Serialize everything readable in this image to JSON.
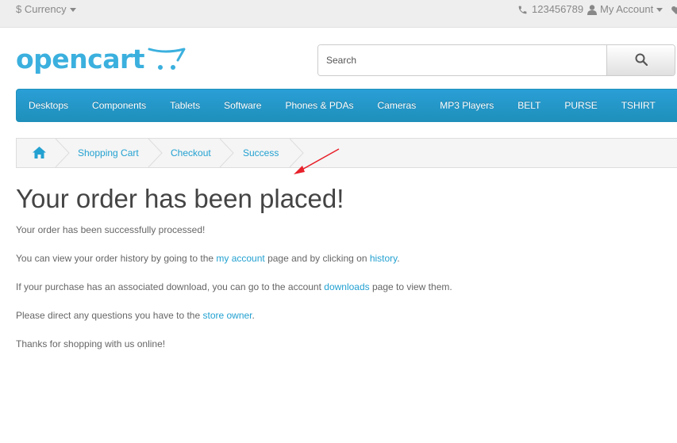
{
  "topbar": {
    "currency_label": "$ Currency",
    "phone": "123456789",
    "account_label": "My Account"
  },
  "logo": {
    "text": "opencart"
  },
  "search": {
    "placeholder": "Search"
  },
  "menu": {
    "items": [
      "Desktops",
      "Components",
      "Tablets",
      "Software",
      "Phones & PDAs",
      "Cameras",
      "MP3 Players",
      "BELT",
      "PURSE",
      "TSHIRT"
    ]
  },
  "breadcrumb": {
    "items": [
      "Shopping Cart",
      "Checkout",
      "Success"
    ]
  },
  "content": {
    "heading": "Your order has been placed!",
    "p1": "Your order has been successfully processed!",
    "p2_before": "You can view your order history by going to the ",
    "p2_link1": "my account",
    "p2_middle": " page and by clicking on ",
    "p2_link2": "history",
    "p2_after": ".",
    "p3_before": "If your purchase has an associated download, you can go to the account ",
    "p3_link": "downloads",
    "p3_after": " page to view them.",
    "p4_before": "Please direct any questions you have to the ",
    "p4_link": "store owner",
    "p4_after": ".",
    "p5": "Thanks for shopping with us online!"
  },
  "colors": {
    "link": "#23a1d1",
    "menu": "#229ac8",
    "annotation": "#e8202a"
  },
  "icons": [
    "caret-down-icon",
    "phone-icon",
    "user-icon",
    "heart-icon",
    "search-icon",
    "home-icon",
    "cart-logo-icon",
    "annotation-arrow"
  ]
}
